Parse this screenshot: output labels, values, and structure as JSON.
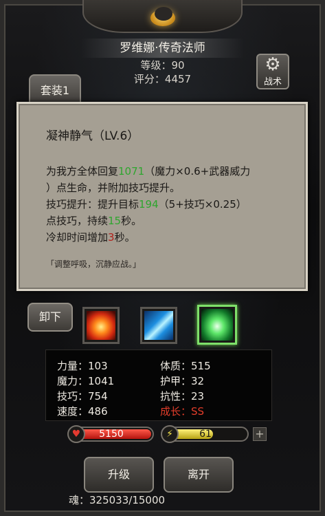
{
  "hero": {
    "name_title": "罗维娜·传奇法师",
    "level_label": "等级：90",
    "score_label": "评分：4457"
  },
  "tabs": {
    "set_label": "套装1"
  },
  "tactic": {
    "label": "战术",
    "icon": "gear-icon"
  },
  "skill": {
    "title": "凝神静气（LV.6）",
    "desc_1a": "为我方全体回复",
    "desc_1b": "1071",
    "desc_1c": "（魔力×0.6+武器威力",
    "desc_2": "）点生命，并附加技巧提升。",
    "desc_3a": "技巧提升：提升目标",
    "desc_3b": "194",
    "desc_3c": "（5+技巧×0.25）",
    "desc_4a": "点技巧，持续",
    "desc_4b": "15",
    "desc_4c": "秒。",
    "desc_5a": "冷却时间增加",
    "desc_5b": "3",
    "desc_5c": "秒。",
    "quote": "「调整呼吸，沉静应战。」"
  },
  "actions": {
    "unequip_label": "卸下",
    "upgrade_label": "升级",
    "leave_label": "离开"
  },
  "skill_slots": [
    {
      "icon": "fire-burst-icon"
    },
    {
      "icon": "ice-slash-icon"
    },
    {
      "icon": "green-heal-icon",
      "selected": true
    }
  ],
  "stats": {
    "power": "力量：103",
    "magic": "魔力：1041",
    "skill": "技巧：754",
    "speed": "速度：486",
    "constitution": "体质：515",
    "armor": "护甲：32",
    "resistance": "抗性：23",
    "growth": "成长：SS"
  },
  "bars": {
    "hp_value": "5150",
    "hp_fill": 1.0,
    "energy_value": "61",
    "energy_fill": 0.61,
    "plus_label": "+"
  },
  "soul": "魂：325033/15000",
  "colors": {
    "heal_green": "#2ea62e",
    "cooldown_red": "#b0201a",
    "growth_red": "#e23d2a"
  }
}
